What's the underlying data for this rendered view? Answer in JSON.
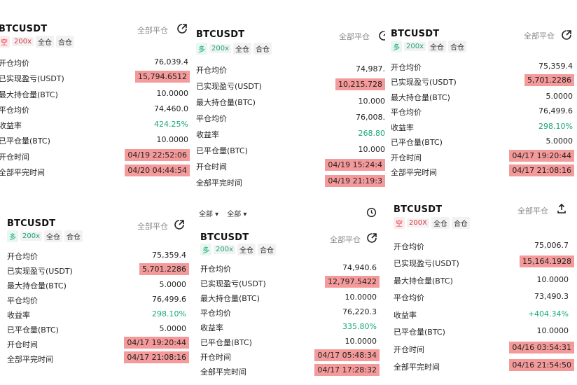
{
  "cards": {
    "c1": {
      "symbol": "BTCUSDT",
      "close_all": "全部平仓",
      "side": "空",
      "leverage": "200x",
      "margin": "全仓",
      "merge": "合仓",
      "rows": [
        {
          "label": "开仓均价",
          "value": "76,039.4"
        },
        {
          "label": "已实现盈亏(USDT)",
          "value": "15,794.6512"
        },
        {
          "label": "最大持仓量(BTC)",
          "value": "10.0000"
        },
        {
          "label": "平仓均价",
          "value": "74,460.0"
        },
        {
          "label": "收益率",
          "value": "424.25%"
        },
        {
          "label": "已平仓量(BTC)",
          "value": "10.0000"
        },
        {
          "label": "开仓时间",
          "value": "04/19 22:52:06"
        },
        {
          "label": "全部平完时间",
          "value": "04/20 04:44:54"
        }
      ]
    },
    "c2": {
      "symbol": "BTCUSDT",
      "close_all": "全部平仓",
      "side": "多",
      "leverage": "200x",
      "margin": "全仓",
      "merge": "合仓",
      "rows": [
        {
          "label": "开仓均价",
          "value": "74,987."
        },
        {
          "label": "已实现盈亏(USDT)",
          "value": "10,215.728"
        },
        {
          "label": "最大持仓量(BTC)",
          "value": "10.000"
        },
        {
          "label": "平仓均价",
          "value": "76,008."
        },
        {
          "label": "收益率",
          "value": "268.80"
        },
        {
          "label": "已平仓量(BTC)",
          "value": "10.000"
        },
        {
          "label": "开仓时间",
          "value": "04/19 15:24:4"
        },
        {
          "label": "全部平完时间",
          "value": "04/19 21:19:3"
        }
      ]
    },
    "c3": {
      "symbol": "BTCUSDT",
      "close_all": "全部平仓",
      "side": "多",
      "leverage": "200x",
      "margin": "全仓",
      "merge": "合仓",
      "rows": [
        {
          "label": "开仓均价",
          "value": "75,359.4"
        },
        {
          "label": "已实现盈亏(USDT)",
          "value": "5,701.2286"
        },
        {
          "label": "最大持仓量(BTC)",
          "value": "5.0000"
        },
        {
          "label": "平仓均价",
          "value": "76,499.6"
        },
        {
          "label": "收益率",
          "value": "298.10%"
        },
        {
          "label": "已平仓量(BTC)",
          "value": "5.0000"
        },
        {
          "label": "开仓时间",
          "value": "04/17 19:20:44"
        },
        {
          "label": "全部平完时间",
          "value": "04/17 21:08:16"
        }
      ]
    },
    "c4": {
      "symbol": "BTCUSDT",
      "close_all": "全部平仓",
      "side": "多",
      "leverage": "200x",
      "margin": "全仓",
      "merge": "合仓",
      "rows": [
        {
          "label": "开仓均价",
          "value": "75,359.4"
        },
        {
          "label": "已实现盈亏(USDT)",
          "value": "5,701.2286"
        },
        {
          "label": "最大持仓量(BTC)",
          "value": "5.0000"
        },
        {
          "label": "平仓均价",
          "value": "76,499.6"
        },
        {
          "label": "收益率",
          "value": "298.10%"
        },
        {
          "label": "已平仓量(BTC)",
          "value": "5.0000"
        },
        {
          "label": "开仓时间",
          "value": "04/17 19:20:44"
        },
        {
          "label": "全部平完时间",
          "value": "04/17 21:08:16"
        }
      ]
    },
    "c5": {
      "symbol": "BTCUSDT",
      "close_all": "全部平仓",
      "side": "多",
      "leverage": "200x",
      "margin": "全仓",
      "merge": "合仓",
      "filter_all_1": "全部",
      "filter_all_2": "全部",
      "rows": [
        {
          "label": "开仓均价",
          "value": "74,940.6"
        },
        {
          "label": "已实现盈亏(USDT)",
          "value": "12,797.5422"
        },
        {
          "label": "最大持仓量(BTC)",
          "value": "10.0000"
        },
        {
          "label": "平仓均价",
          "value": "76,220.3"
        },
        {
          "label": "收益率",
          "value": "335.80%"
        },
        {
          "label": "已平仓量(BTC)",
          "value": "10.0000"
        },
        {
          "label": "开仓时间",
          "value": "04/17 05:48:34"
        },
        {
          "label": "全部平完时间",
          "value": "04/17 17:28:32"
        }
      ]
    },
    "c6": {
      "symbol": "BTCUSDT",
      "close_all": "全部平仓",
      "side": "空",
      "leverage": "200X",
      "margin": "全仓",
      "merge": "合仓",
      "rows": [
        {
          "label": "开仓均价",
          "value": "75,006.7"
        },
        {
          "label": "已实现盈亏(USDT)",
          "value": "15,164.1928"
        },
        {
          "label": "最大持仓量(BTC)",
          "value": "10.0000"
        },
        {
          "label": "平仓均价",
          "value": "73,490.3"
        },
        {
          "label": "收益率",
          "value": "+404.34%"
        },
        {
          "label": "已平仓量(BTC)",
          "value": "10.0000"
        },
        {
          "label": "开仓时间",
          "value": "04/16 03:54:31"
        },
        {
          "label": "全部平完时间",
          "value": "04/16 21:54:50"
        }
      ]
    }
  },
  "colors": {
    "highlight": "#f59a9a",
    "profit": "#19a873",
    "loss": "#e0323f"
  }
}
